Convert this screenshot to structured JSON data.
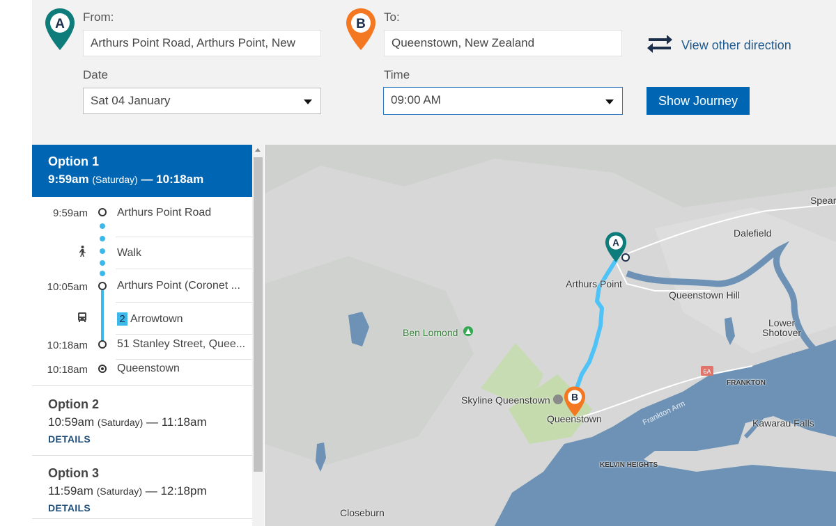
{
  "form": {
    "from_label": "From:",
    "from_value": "Arthurs Point Road, Arthurs Point, New",
    "to_label": "To:",
    "to_value": "Queenstown, New Zealand",
    "date_label": "Date",
    "date_value": "Sat 04 January",
    "time_label": "Time",
    "time_value": "09:00 AM",
    "view_other_direction": "View other direction",
    "show_journey": "Show Journey",
    "pin_a": "A",
    "pin_b": "B"
  },
  "options": [
    {
      "title": "Option 1",
      "depart": "9:59am",
      "day": "(Saturday)",
      "dash": "—",
      "arrive": "10:18am",
      "steps": [
        {
          "time": "9:59am",
          "text": "Arthurs Point Road"
        },
        {
          "text": "Walk"
        },
        {
          "time": "10:05am",
          "text": "Arthurs Point (Coronet ..."
        },
        {
          "route": "2",
          "text": "Arrowtown"
        },
        {
          "time": "10:18am",
          "text": "51 Stanley Street, Quee..."
        },
        {
          "time": "10:18am",
          "text": "Queenstown"
        }
      ]
    },
    {
      "title": "Option 2",
      "depart": "10:59am",
      "day": "(Saturday)",
      "dash": "—",
      "arrive": "11:18am",
      "details": "DETAILS"
    },
    {
      "title": "Option 3",
      "depart": "11:59am",
      "day": "(Saturday)",
      "dash": "—",
      "arrive": "12:18pm",
      "details": "DETAILS"
    }
  ],
  "map": {
    "labels": {
      "spear": "Spear",
      "dalefield": "Dalefield",
      "arthurs_point": "Arthurs Point",
      "queenstown_hill": "Queenstown Hill",
      "lower_shotover_1": "Lower",
      "lower_shotover_2": "Shotover",
      "ben_lomond": "Ben Lomond",
      "frankton": "FRANKTON",
      "skyline": "Skyline Queenstown",
      "queenstown": "Queenstown",
      "frankton_arm": "Frankton Arm",
      "kawarau_falls": "Kawarau Falls",
      "kelvin_heights": "KELVIN HEIGHTS",
      "closeburn": "Closeburn",
      "route_6a": "6A"
    }
  },
  "colors": {
    "brand_blue": "#0066b3",
    "pin_a": "#0e7c7b",
    "pin_b": "#f47721",
    "route": "#4fc3f7",
    "water": "#6d92b6"
  }
}
